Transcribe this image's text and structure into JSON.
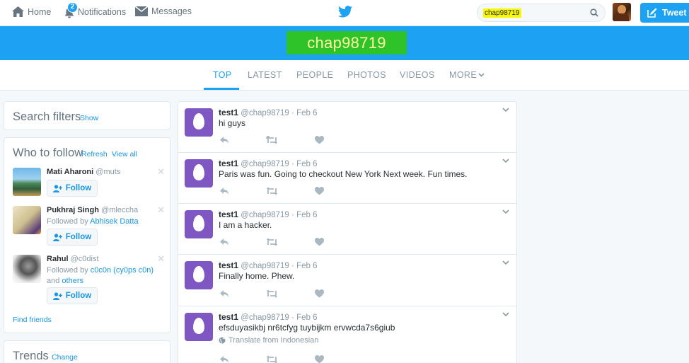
{
  "nav": {
    "home": "Home",
    "notifications": "Notifications",
    "notif_count": "2",
    "messages": "Messages",
    "tweet_button": "Tweet"
  },
  "search": {
    "value": "chap98719"
  },
  "query_title": "chap98719",
  "tabs": [
    {
      "label": "TOP",
      "active": true
    },
    {
      "label": "LATEST"
    },
    {
      "label": "PEOPLE"
    },
    {
      "label": "PHOTOS"
    },
    {
      "label": "VIDEOS"
    },
    {
      "label": "MORE"
    }
  ],
  "search_filters": {
    "title": "Search filters",
    "show": "Show"
  },
  "who_to_follow": {
    "title": "Who to follow",
    "refresh": "Refresh",
    "view_all": "View all",
    "follow_label": "Follow",
    "users": [
      {
        "name": "Mati Aharoni",
        "handle": "@muts"
      },
      {
        "name": "Pukhraj Singh",
        "handle": "@mleccha",
        "followed_by_prefix": "Followed by",
        "followed_by": "Abhisek Datta"
      },
      {
        "name": "Rahul",
        "handle": "@c0dist",
        "followed_by_prefix": "Followed by",
        "followed_by": "c0c0n (cy0ps c0n)",
        "and": "and",
        "others": "others"
      }
    ],
    "find_friends": "Find friends"
  },
  "trends": {
    "title": "Trends",
    "change": "Change"
  },
  "tweets": [
    {
      "name": "test1",
      "handle": "@chap98719",
      "date": "Feb 6",
      "text": "hi guys"
    },
    {
      "name": "test1",
      "handle": "@chap98719",
      "date": "Feb 6",
      "text": "Paris was fun. Going to checkout New York Next week. Fun times."
    },
    {
      "name": "test1",
      "handle": "@chap98719",
      "date": "Feb 6",
      "text": "I am a hacker."
    },
    {
      "name": "test1",
      "handle": "@chap98719",
      "date": "Feb 6",
      "text": "Finally home. Phew."
    },
    {
      "name": "test1",
      "handle": "@chap98719",
      "date": "Feb 6",
      "text": "efsduyasikbj nr6tcfyg tuybijkm ervwcda7s6giub",
      "translate": "Translate from Indonesian"
    }
  ],
  "colors": {
    "accent": "#1da1f2",
    "egg_avatar": "#7e57c2",
    "highlight": "#f7f900",
    "query_box": "#2fc32a"
  }
}
